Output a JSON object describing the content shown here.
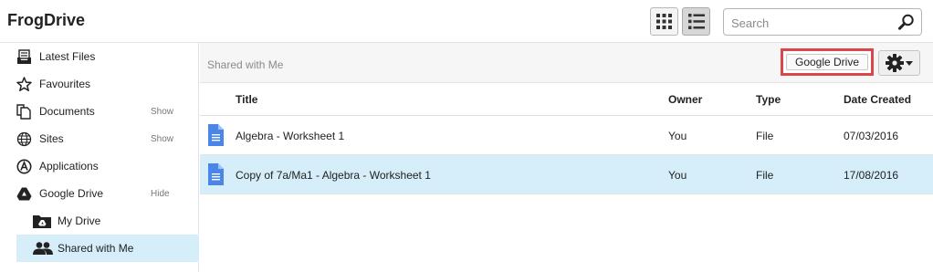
{
  "app": {
    "title": "FrogDrive"
  },
  "search": {
    "placeholder": "Search"
  },
  "sidebar": {
    "items": [
      {
        "label": "Latest Files",
        "icon": "tray-icon"
      },
      {
        "label": "Favourites",
        "icon": "star-icon"
      },
      {
        "label": "Documents",
        "icon": "documents-icon",
        "action": "Show"
      },
      {
        "label": "Sites",
        "icon": "globe-icon",
        "action": "Show"
      },
      {
        "label": "Applications",
        "icon": "applications-icon"
      },
      {
        "label": "Google Drive",
        "icon": "google-drive-icon",
        "action": "Hide"
      },
      {
        "label": "My Drive",
        "icon": "drive-folder-icon"
      },
      {
        "label": "Shared with Me",
        "icon": "people-icon",
        "selected": true
      }
    ]
  },
  "main": {
    "breadcrumb": "Shared with Me",
    "google_drive_button": "Google Drive",
    "columns": {
      "title": "Title",
      "owner": "Owner",
      "type": "Type",
      "date": "Date Created"
    },
    "rows": [
      {
        "title": "Algebra - Worksheet 1",
        "owner": "You",
        "type": "File",
        "date": "07/03/2016"
      },
      {
        "title": "Copy of 7a/Ma1 - Algebra - Worksheet 1",
        "owner": "You",
        "type": "File",
        "date": "17/08/2016",
        "selected": true
      }
    ]
  },
  "colors": {
    "selected_row": "#d5eefa",
    "highlight_border": "#d9474b",
    "doc_icon": "#4a86e8"
  }
}
